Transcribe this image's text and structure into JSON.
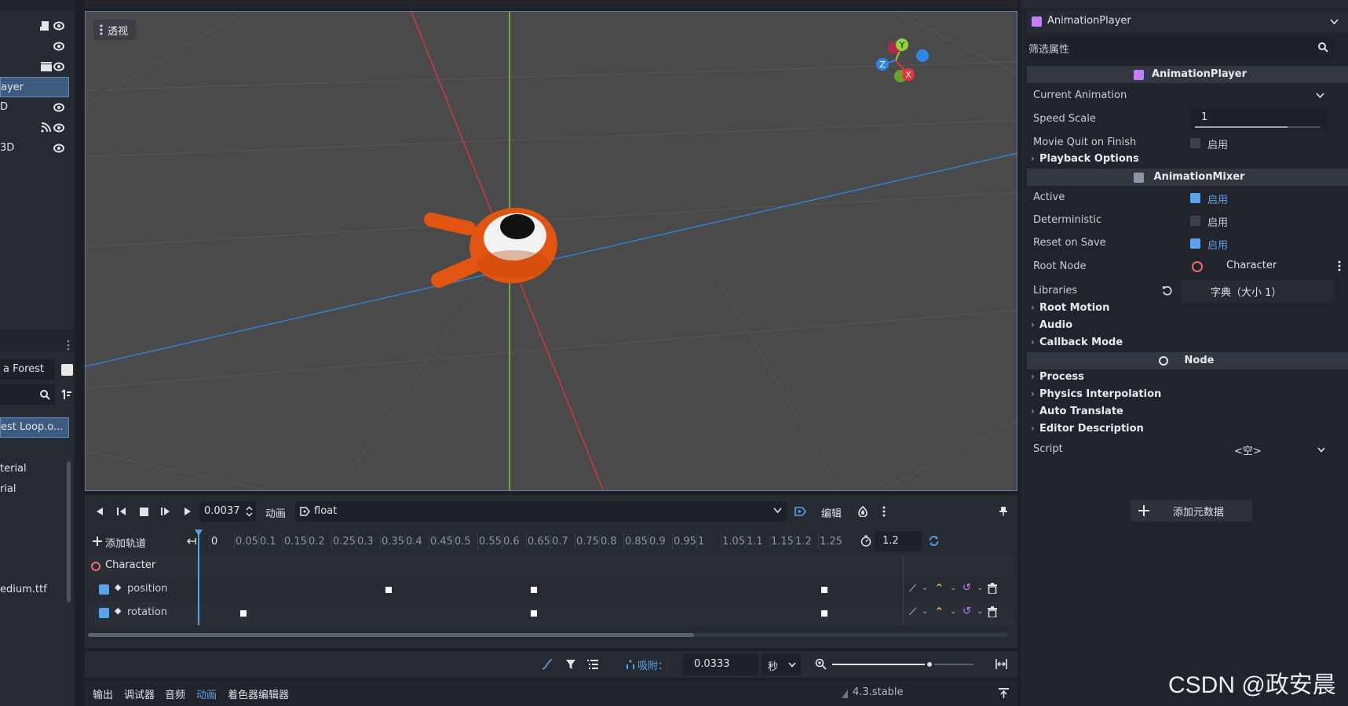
{
  "left_panel": {
    "tree_items": [
      {
        "label": "",
        "icon": "film-icon"
      },
      {
        "label": "",
        "icon": ""
      },
      {
        "label": "",
        "icon": "clapperboard-icon"
      },
      {
        "label": "ayer",
        "selected": true
      },
      {
        "label": "D"
      },
      {
        "label": "",
        "icon": "signal-icon"
      },
      {
        "label": "3D"
      }
    ],
    "filesystem": {
      "path_label": "a Forest",
      "file_items": [
        "est Loop.o...",
        "terial",
        "rial",
        "edium.ttf"
      ]
    }
  },
  "viewport": {
    "view_mode": "透视",
    "gizmo_labels": {
      "y": "Y",
      "z": "Z",
      "x": "X"
    },
    "colors": {
      "x_axis": "#e8323e",
      "y_axis": "#8fd43a",
      "z_axis": "#2f86e8",
      "character": "#e25510"
    }
  },
  "animation": {
    "time_value": "0.0037",
    "animation_menu": "动画",
    "current_animation": "float",
    "edit_menu": "编辑",
    "add_track": "添加轨道",
    "length": "1.2",
    "ticks": [
      "0",
      "0.05",
      "0.1",
      "0.15",
      "0.2",
      "0.25",
      "0.3",
      "0.35",
      "0.4",
      "0.45",
      "0.5",
      "0.55",
      "0.6",
      "0.65",
      "0.7",
      "0.75",
      "0.8",
      "0.85",
      "0.9",
      "0.95",
      "1",
      "1.05",
      "1.1",
      "1.15",
      "1.2",
      "1.25"
    ],
    "tracks": [
      {
        "label": "Character",
        "type": "node"
      },
      {
        "label": "position",
        "type": "property",
        "checked": true,
        "keys": [
          0.3,
          0.6,
          1.2
        ]
      },
      {
        "label": "rotation",
        "type": "property",
        "checked": true,
        "keys": [
          0.0,
          0.6,
          1.2
        ]
      }
    ],
    "snap_label": "吸附：",
    "snap_value": "0.0333",
    "snap_unit": "秒"
  },
  "dock_tabs": [
    "输出",
    "调试器",
    "音频",
    "动画",
    "着色器编辑器"
  ],
  "dock_active": "动画",
  "version": "4.3.stable",
  "watermark": "CSDN @政安晨",
  "inspector": {
    "node_selector": "AnimationPlayer",
    "filter_placeholder": "筛选属性",
    "section_animationplayer": "AnimationPlayer",
    "current_animation_label": "Current Animation",
    "current_animation_value": "",
    "speed_scale_label": "Speed Scale",
    "speed_scale_value": "1",
    "speed_scale_level": 0.74,
    "movie_quit_label": "Movie Quit on Finish",
    "enable_label": "启用",
    "playback_options": "Playback Options",
    "section_animationmixer": "AnimationMixer",
    "active_label": "Active",
    "deterministic_label": "Deterministic",
    "reset_on_save_label": "Reset on Save",
    "root_node_label": "Root Node",
    "root_node_value": "Character",
    "libraries_label": "Libraries",
    "libraries_value": "字典（大小 1）",
    "root_motion": "Root Motion",
    "audio": "Audio",
    "callback_mode": "Callback Mode",
    "section_node": "Node",
    "process": "Process",
    "physics_interpolation": "Physics Interpolation",
    "auto_translate": "Auto Translate",
    "editor_description": "Editor Description",
    "script_label": "Script",
    "script_value": "<空>",
    "add_metadata": "添加元数据"
  }
}
